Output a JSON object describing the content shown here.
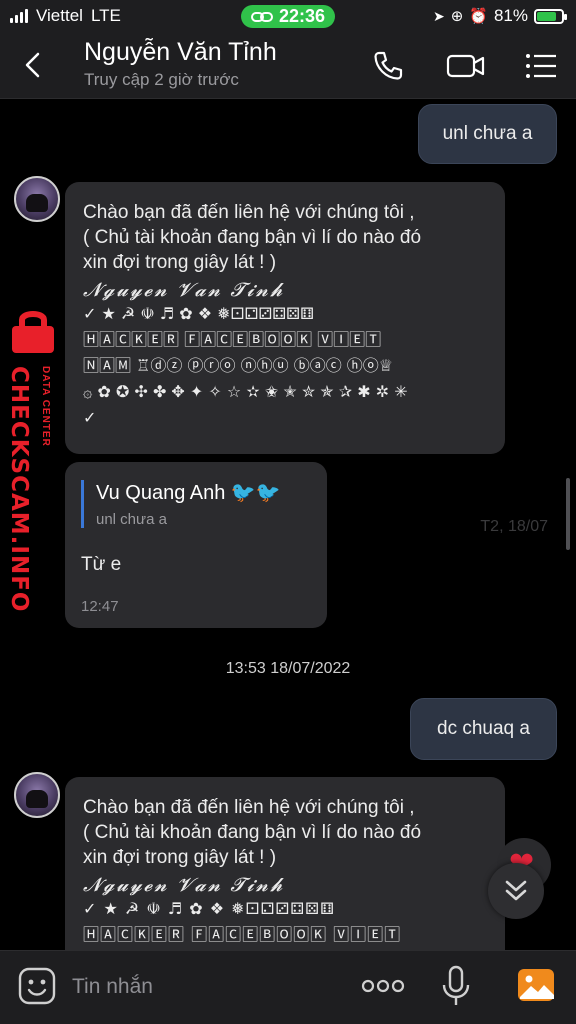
{
  "status_bar": {
    "carrier": "Viettel",
    "network": "LTE",
    "time": "22:36",
    "battery": "81%",
    "battery_level": 0.81
  },
  "header": {
    "contact_name": "Nguyễn Văn Tỉnh",
    "last_seen": "Truy cập 2 giờ trước"
  },
  "messages": {
    "out1": "unl chưa a",
    "auto_reply_1": {
      "text": "Chào bạn đã đến liên hệ với chúng tôi ,\n( Chủ tài khoản đang bận vì lí do nào đó\nxin đợi trong giây lát ! )",
      "signature": "𝓝𝓰𝓾𝔂𝓮𝓷 𝓥𝓪𝓷 𝓣𝓲𝓷𝓱",
      "symbols": "✓ ★ ☭ ☫ ♬ ✿ ❖ ❅⚀⚁⚂⚃⚄⚅\n🄷🄰🄲🄺🄴🅁 🄵🄰🄲🄴🄱🄾🄾🄺 🅅🄸🄴🅃\n🄽🄰🄼 ♖ⓓⓩ ⓟⓡⓞ ⓝⓗⓤ ⓑⓐⓒ ⓗⓞ♕\n۞ ✿ ✪ ✣ ✤ ✥ ✦ ✧ ☆ ✫ ✬ ✭ ✮ ✯ ✰ ✱ ✲ ✳\n✓"
    },
    "reply_card": {
      "quoted_name": "Vu Quang Anh 🐦🐦",
      "quoted_text": "unl chưa a",
      "text": "Từ e",
      "time": "12:47"
    },
    "faded_time": "T2, 18/07",
    "date_divider": "13:53 18/07/2022",
    "out2": "dc chuaq a",
    "auto_reply_2": {
      "text": "Chào bạn đã đến liên hệ với chúng tôi ,\n( Chủ tài khoản đang bận vì lí do nào đó\nxin đợi trong giây lát ! )",
      "signature": "𝓝𝓰𝓾𝔂𝓮𝓷 𝓥𝓪𝓷 𝓣𝓲𝓷𝓱",
      "symbols": "✓ ★ ☭ ☫ ♬ ✿ ❖ ❅⚀⚁⚂⚃⚄⚅\n🄷🄰🄲🄺🄴🅁 🄵🄰🄲🄴🄱🄾🄾🄺 🅅🄸🄴🅃"
    }
  },
  "watermark": {
    "main": "CHECKSCAM.INFO",
    "sub": "DATA CENTER"
  },
  "input": {
    "placeholder": "Tin nhắn"
  },
  "colors": {
    "accent_green": "#30c24a",
    "outgoing_bubble": "#2d3544",
    "incoming_bubble": "#2b2b2e",
    "watermark_red": "#e8202a",
    "quote_bar": "#3a78d8"
  },
  "icons": [
    "back-icon",
    "phone-icon",
    "video-call-icon",
    "menu-list-icon",
    "emoji-icon",
    "more-icon",
    "mic-icon",
    "photo-icon",
    "heart-icon",
    "chevron-double-down-icon"
  ]
}
